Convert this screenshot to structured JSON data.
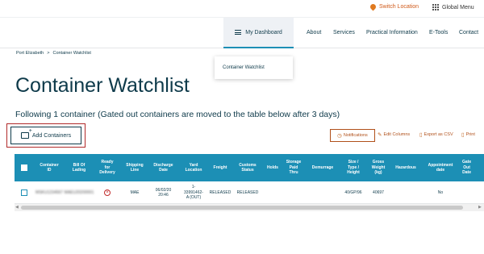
{
  "topbar": {
    "switch_location": "Switch Location",
    "global_menu": "Global Menu"
  },
  "nav": {
    "dashboard": "My Dashboard",
    "items": [
      "About",
      "Services",
      "Practical Information",
      "E-Tools",
      "Contact"
    ]
  },
  "dropdown": {
    "item": "Container Watchlist"
  },
  "breadcrumb": {
    "home": "Port Elizabeth",
    "separator": ">",
    "current": "Container Watchlist"
  },
  "page": {
    "title": "Container Watchlist",
    "subtitle": "Following 1 container (Gated out containers are moved to the table below after 3 days)"
  },
  "add_button": "Add Containers",
  "actions": {
    "notifications": "Notifications",
    "edit_columns": "Edit Columns",
    "export_csv": "Export as CSV",
    "print": "Print"
  },
  "table": {
    "columns": [
      "Container\nID",
      "Bill Of\nLading",
      "Ready\nfor\nDelivery",
      "Shipping\nLine",
      "Discharge\nDate",
      "Yard\nLocation",
      "Freight",
      "Customs\nStatus",
      "Holds",
      "Storage\nPaid\nThru",
      "Demurrage",
      "Size /\nType /\nHeight",
      "Gross\nWeight\n(kg)",
      "Hazardous",
      "Appointment\ndate",
      "Gate\nOut\nDate"
    ],
    "row": {
      "container_id": "MSKU1234567",
      "bill_of_lading": "MAEU20200001",
      "shipping_line": "MAE",
      "discharge_date": "06/02/20\n20:46",
      "yard_location": "1-\n33991462-\nA (OUT)",
      "freight": "RELEASED",
      "customs_status": "RELEASED",
      "size_type_height": "40/GP/96",
      "gross_weight": "40697",
      "appointment_date": "No"
    }
  },
  "colors": {
    "accent": "#1c8fb5",
    "text": "#0e3a4a",
    "action": "#b0501a",
    "alert": "#c02a2a"
  }
}
